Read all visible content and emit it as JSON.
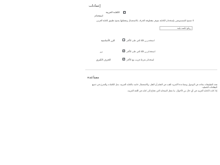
{
  "settings": {
    "title": "إعدادات",
    "item1": {
      "label": "الكتابة العربية",
      "checked": true,
      "desc_label": "استخدام"
    },
    "description": "لا تسمح للمسموعين بإستخدام الكتابة متوفر مقطوعة الحرف بالاستعمال وتعطيلها يصبح تطبيق لكتابة العربي",
    "name_input": {
      "value": "ريكو خلسة بلينة"
    },
    "hotkeys": [
      {
        "label": "الزر الأساسية",
        "hint": "استخدم زر Alt التي على الأكثر",
        "checked": false
      },
      {
        "label": "زر",
        "hint": "استخدام زر Alt التي على الأكثر",
        "checked": true
      },
      {
        "label": "الحرف الكبرى",
        "hint": "استخدام شرط قريب مع الأكثر",
        "checked": true
      }
    ]
  },
  "help": {
    "title": "مساعدة",
    "lines": [
      "هذه التطبيقات متاحة في الوصول ومساعدة الأسرية للعب في التعلم أو النقل، والاستعمال خاصة بالكتابة العربية، مثل الكلمات والشرح في جميع البطاقات الخطية.",
      "إذا كانت الكتابة العربية في أي حال من الأحوال، ما شغل السحابة التي تحتاج إلى كتابة في اللغة العربية."
    ]
  }
}
